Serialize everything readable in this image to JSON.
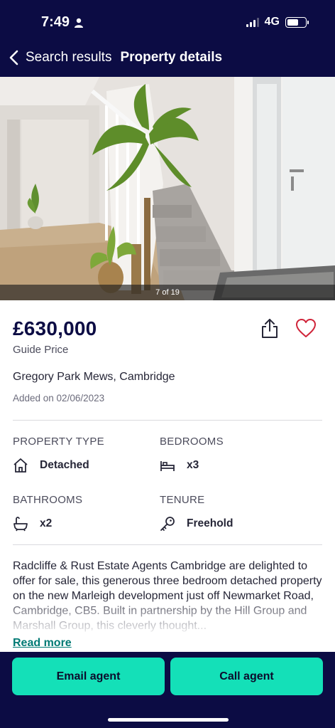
{
  "status_bar": {
    "time": "7:49",
    "network": "4G"
  },
  "nav": {
    "back_label": "Search results",
    "title": "Property details"
  },
  "photo": {
    "counter": "7 of 19"
  },
  "listing": {
    "price": "£630,000",
    "price_qualifier": "Guide Price",
    "address": "Gregory Park Mews, Cambridge",
    "added": "Added on 02/06/2023"
  },
  "key_features": [
    {
      "label": "PROPERTY TYPE",
      "value": "Detached",
      "icon": "house-icon"
    },
    {
      "label": "BEDROOMS",
      "value": "x3",
      "icon": "bed-icon"
    },
    {
      "label": "BATHROOMS",
      "value": "x2",
      "icon": "bath-icon"
    },
    {
      "label": "TENURE",
      "value": "Freehold",
      "icon": "key-icon"
    }
  ],
  "description": "Radcliffe & Rust Estate Agents Cambridge are delighted to offer for sale, this generous three bedroom detached property on the new Marleigh development just off Newmarket Road, Cambridge, CB5. Built in partnership by the Hill Group and Marshall Group, this cleverly thought...",
  "read_more_label": "Read more",
  "actions": {
    "email_label": "Email agent",
    "call_label": "Call agent"
  },
  "colors": {
    "navy": "#0c0c44",
    "accent": "#14e0b8",
    "link": "#007a74",
    "heart": "#d0253a"
  }
}
